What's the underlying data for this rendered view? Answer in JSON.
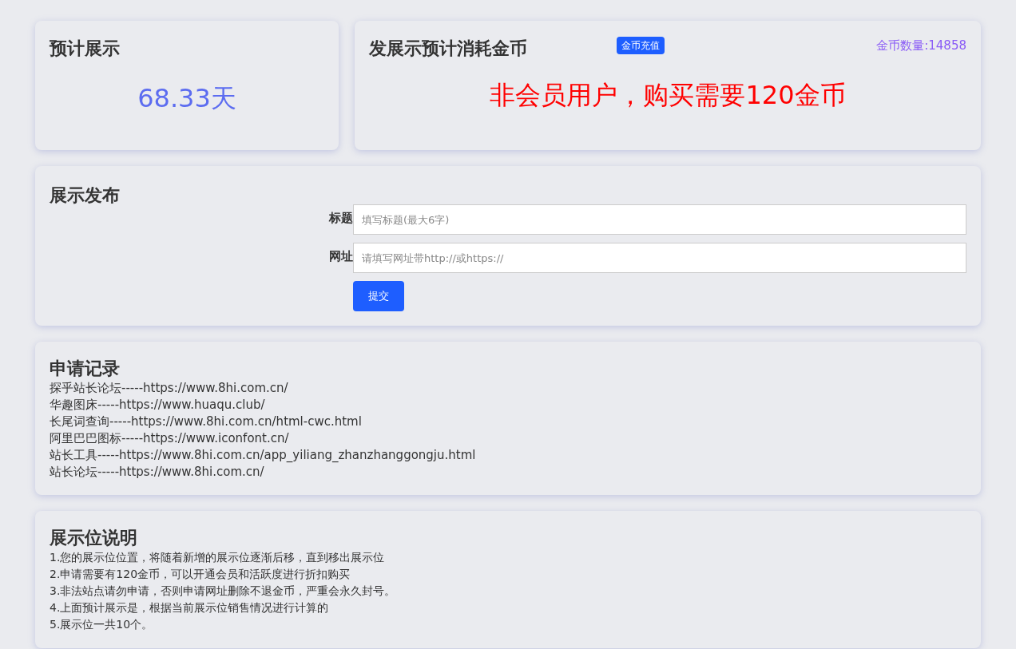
{
  "estimate": {
    "title": "预计展示",
    "value": "68.33天"
  },
  "cost": {
    "title": "发展示预计消耗金币",
    "recharge_button": "金币充值",
    "coin_count": "金币数量:14858",
    "notice": "非会员用户，购买需要120金币"
  },
  "publish": {
    "title": "展示发布",
    "fields": [
      {
        "label": "标题",
        "placeholder": "填写标题(最大6字)"
      },
      {
        "label": "网址",
        "placeholder": "请填写网址带http://或https://"
      }
    ],
    "submit": "提交"
  },
  "records": {
    "title": "申请记录",
    "items": [
      "探乎站长论坛-----https://www.8hi.com.cn/",
      "华趣图床-----https://www.huaqu.club/",
      "长尾词查询-----https://www.8hi.com.cn/html-cwc.html",
      "阿里巴巴图标-----https://www.iconfont.cn/",
      "站长工具-----https://www.8hi.com.cn/app_yiliang_zhanzhanggongju.html",
      "站长论坛-----https://www.8hi.com.cn/"
    ]
  },
  "notes": {
    "title": "展示位说明",
    "items": [
      "1.您的展示位位置，将随着新增的展示位逐渐后移，直到移出展示位",
      "2.申请需要有120金币，可以开通会员和活跃度进行折扣购买",
      "3.非法站点请勿申请，否则申请网址删除不退金币，严重会永久封号。",
      "4.上面预计展示是，根据当前展示位销售情况进行计算的",
      "5.展示位一共10个。"
    ]
  }
}
